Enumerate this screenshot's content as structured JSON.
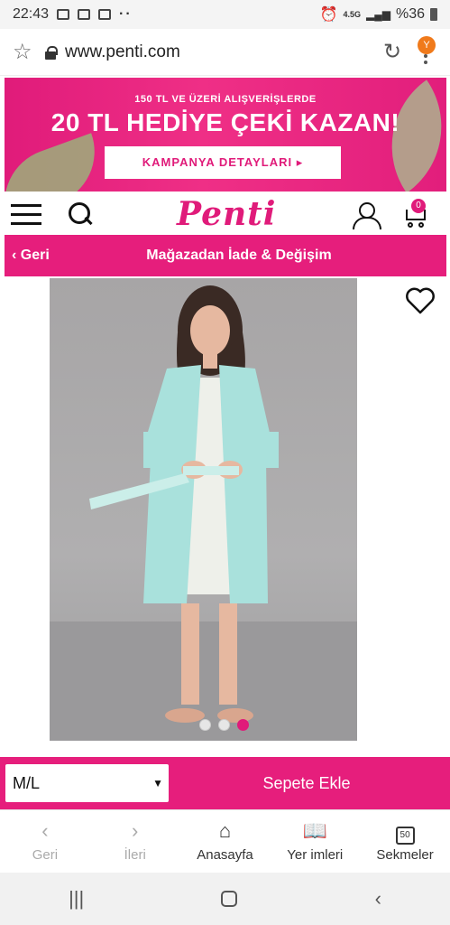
{
  "status_bar": {
    "time": "22:43",
    "network": "4.5G",
    "battery": "%36",
    "more": "··"
  },
  "browser": {
    "url": "www.penti.com",
    "account_initial": "Y"
  },
  "banner": {
    "line1": "150 TL VE ÜZERİ ALIŞVERİŞLERDE",
    "line2": "20 TL HEDİYE ÇEKİ KAZAN!",
    "button": "KAMPANYA DETAYLARI ▸"
  },
  "header": {
    "logo": "Penti",
    "cart_count": "0"
  },
  "nav": {
    "back": "Geri",
    "title": "Mağazadan İade & Değişim"
  },
  "product": {
    "carousel_dots": 3,
    "active_dot": 3
  },
  "action_bar": {
    "size": "M/L",
    "add_to_cart": "Sepete Ekle"
  },
  "browser_nav": {
    "back": "Geri",
    "forward": "İleri",
    "home": "Anasayfa",
    "bookmarks": "Yer imleri",
    "tabs": "Sekmeler",
    "tabs_count": "50"
  },
  "colors": {
    "brand": "#e61e7c",
    "accent_badge": "#f07a1b"
  }
}
